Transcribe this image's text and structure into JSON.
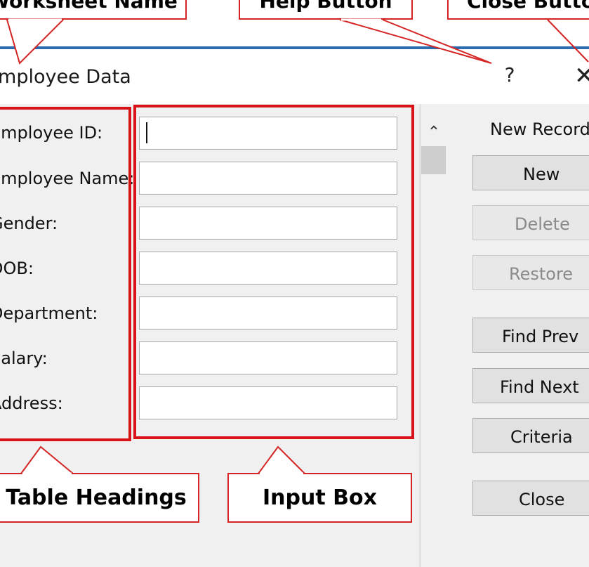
{
  "callouts": {
    "worksheet_name": "Worksheet Name",
    "help_button": "Help Button",
    "close_button": "Close Button",
    "table_headings": "Table Headings",
    "input_box": "Input Box"
  },
  "dialog": {
    "title": "Employee Data",
    "help_glyph": "?",
    "close_glyph": "✕",
    "record_status": "New Record"
  },
  "fields": [
    {
      "label": "Employee ID:",
      "value": ""
    },
    {
      "label": "Employee Name:",
      "value": ""
    },
    {
      "label": "Gender:",
      "value": ""
    },
    {
      "label": "DOB:",
      "value": ""
    },
    {
      "label": "Department:",
      "value": ""
    },
    {
      "label": "Salary:",
      "value": ""
    },
    {
      "label": "Address:",
      "value": ""
    }
  ],
  "buttons": [
    {
      "label": "New",
      "enabled": true
    },
    {
      "label": "Delete",
      "enabled": false
    },
    {
      "label": "Restore",
      "enabled": false
    },
    {
      "label": "Find Prev",
      "enabled": true
    },
    {
      "label": "Find Next",
      "enabled": true
    },
    {
      "label": "Criteria",
      "enabled": true
    },
    {
      "label": "Close",
      "enabled": true
    }
  ],
  "colors": {
    "callout_border": "#d42424",
    "highlight_frame": "#d8141a",
    "title_rule": "#2b6cb0",
    "dialog_background": "#f0f0f0"
  },
  "icons": {
    "scroll_up": "chevron-up-icon",
    "close": "close-icon",
    "help": "help-icon"
  }
}
